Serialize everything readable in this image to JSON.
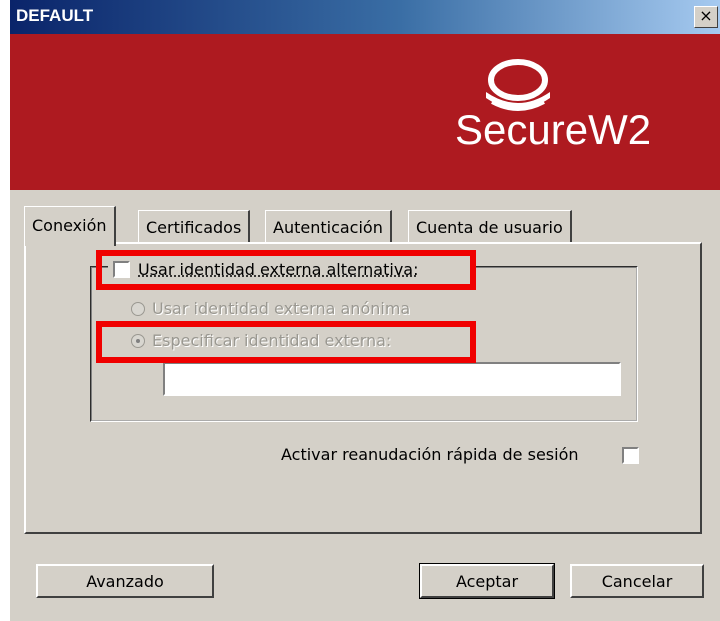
{
  "window": {
    "title": "DEFAULT",
    "close_label": "×"
  },
  "banner": {
    "logo_text": "SecureW2",
    "color": "#ae1a20"
  },
  "tabs": [
    {
      "label": "Conexión",
      "active": true
    },
    {
      "label": "Certificados",
      "active": false
    },
    {
      "label": "Autenticación",
      "active": false
    },
    {
      "label": "Cuenta de usuario",
      "active": false
    }
  ],
  "connection": {
    "alt_identity_label": "Usar identidad externa alternativa:",
    "alt_identity_checked": false,
    "anonymous_label": "Usar identidad externa anónima",
    "specify_label": "Especificar identidad externa:",
    "specify_value": "",
    "fast_resume_label": "Activar reanudación rápida de sesión",
    "fast_resume_checked": false
  },
  "buttons": {
    "advanced": "Avanzado",
    "accept": "Aceptar",
    "cancel": "Cancelar"
  },
  "annotation_color": "#f00000"
}
